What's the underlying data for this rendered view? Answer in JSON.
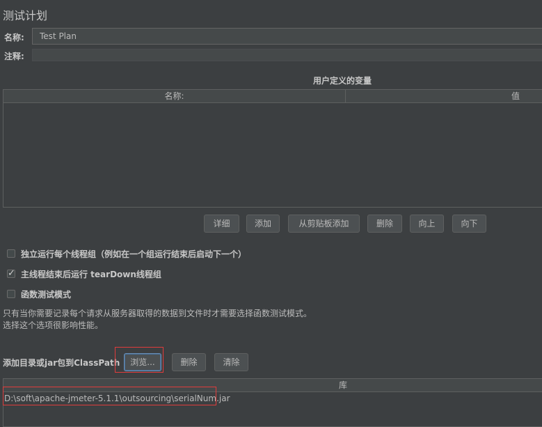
{
  "page": {
    "title": "测试计划",
    "name_label": "名称:",
    "name_value": "Test Plan",
    "comment_label": "注释:",
    "comment_value": ""
  },
  "variables": {
    "section_title": "用户定义的变量",
    "columns": [
      "名称:",
      "值"
    ],
    "rows": [],
    "buttons": [
      "详细",
      "添加",
      "从剪贴板添加",
      "删除",
      "向上",
      "向下"
    ]
  },
  "options": [
    {
      "label": "独立运行每个线程组（例如在一个组运行结束后启动下一个）",
      "checked": false
    },
    {
      "label": "主线程结束后运行 tearDown线程组",
      "checked": true
    },
    {
      "label": "函数测试模式",
      "checked": false
    }
  ],
  "notes": [
    "只有当你需要记录每个请求从服务器取得的数据到文件时才需要选择函数测试模式。",
    "选择这个选项很影响性能。"
  ],
  "classpath": {
    "label": "添加目录或jar包到ClassPath",
    "browse_label": "浏览...",
    "delete_label": "删除",
    "clear_label": "清除",
    "column": "库",
    "rows": [
      "D:\\soft\\apache-jmeter-5.1.1\\outsourcing\\serialNum.jar"
    ]
  },
  "colors": {
    "background": "#3c3f41",
    "highlight": "#e03c3c"
  }
}
